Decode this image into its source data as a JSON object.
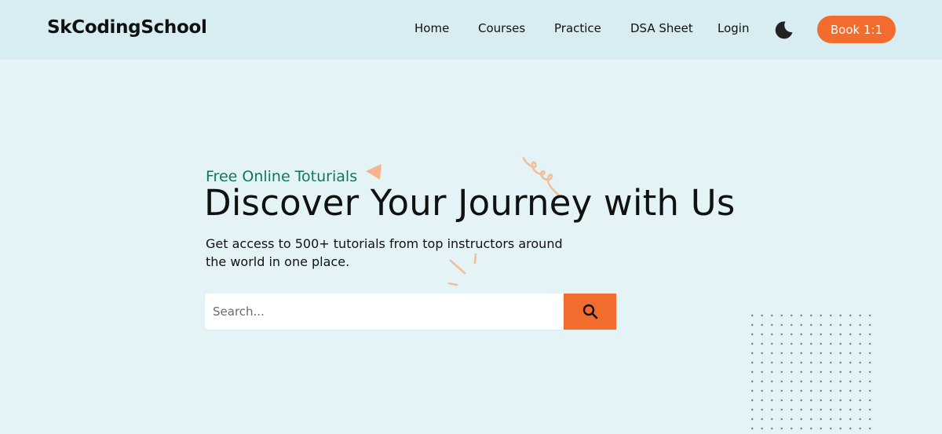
{
  "header": {
    "logo": "SkCodingSchool",
    "nav": [
      {
        "label": "Home"
      },
      {
        "label": "Courses"
      },
      {
        "label": "Practice"
      },
      {
        "label": "DSA Sheet"
      },
      {
        "label": "Login"
      }
    ],
    "theme_toggle_icon": "moon-icon",
    "cta_label": "Book 1:1"
  },
  "hero": {
    "eyebrow": "Free Online Toturials",
    "title": "Discover Your Journey with Us",
    "subtitle": "Get access to 500+ tutorials from top instructors around the world in one place.",
    "search": {
      "placeholder": "Search...",
      "button_icon": "search-icon"
    }
  },
  "colors": {
    "accent": "#f26c2e",
    "eyebrow": "#0c7a5a",
    "background": "#e4f4f6",
    "header_background": "#d7edf1"
  }
}
